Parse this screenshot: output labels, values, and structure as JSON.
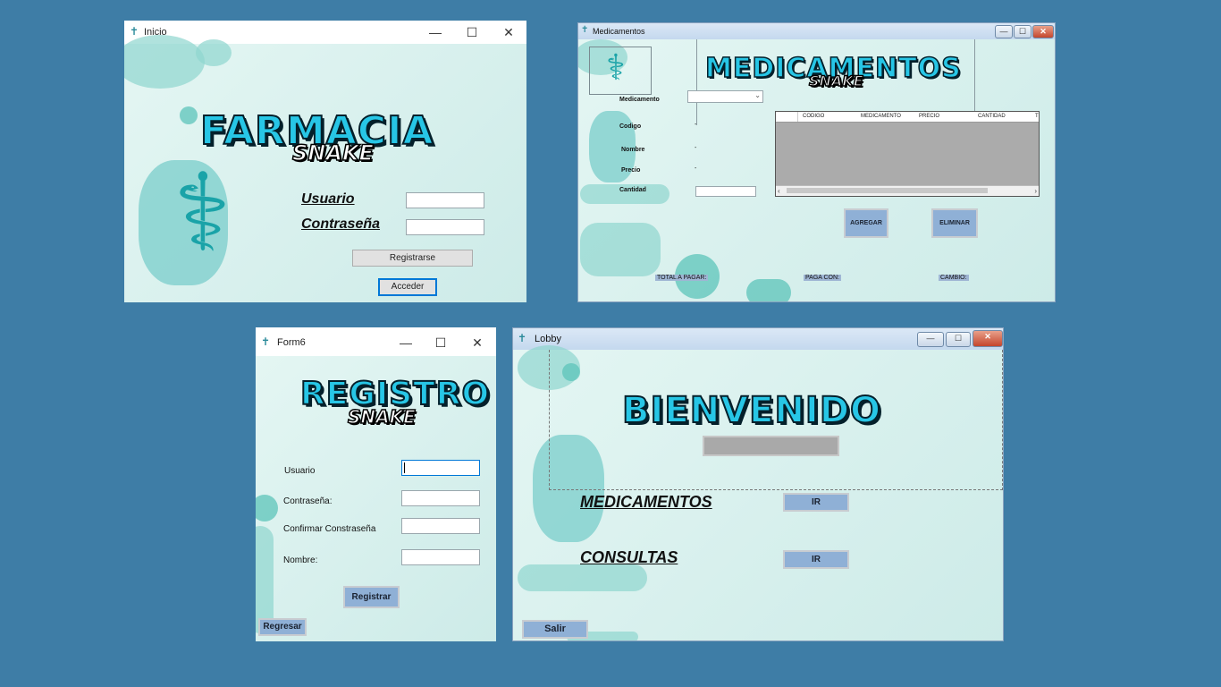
{
  "inicio": {
    "title": "Inicio",
    "logo": "FARMACIA",
    "logo_sub": "SNAKE",
    "usuario_label": "Usuario",
    "contrasena_label": "Contraseña",
    "registrarse_button": "Registrarse",
    "acceder_button": "Acceder"
  },
  "medicamentos": {
    "title": "Medicamentos",
    "logo": "MEDICAMENTOS",
    "logo_sub": "SNAKE",
    "fields": {
      "medicamento": "Medicamento",
      "codigo": "Codigo",
      "nombre": "Nombre",
      "precio": "Precio",
      "cantidad": "Cantidad"
    },
    "placeholder_dash": "-",
    "grid_columns": [
      "CODIGO",
      "MEDICAMENTO",
      "PRECIO",
      "CANTIDAD",
      "T"
    ],
    "agregar_button": "AGREGAR",
    "eliminar_button": "ELIMINAR",
    "total_label": "TOTAL A PAGAR:",
    "paga_con_label": "PAGA CON:",
    "cambio_label": "CAMBIO:"
  },
  "form6": {
    "title": "Form6",
    "logo": "REGISTRO",
    "logo_sub": "SNAKE",
    "usuario_label": "Usuario",
    "contrasena_label": "Contraseña:",
    "confirmar_label": "Confirmar Constraseña",
    "nombre_label": "Nombre:",
    "registrar_button": "Registrar",
    "regresar_button": "Regresar"
  },
  "lobby": {
    "title": "Lobby",
    "logo": "BIENVENIDO",
    "medicamentos_label": "MEDICAMENTOS",
    "consultas_label": "CONSULTAS",
    "ir_button": "IR",
    "salir_button": "Salir"
  },
  "icons": {
    "min": "—",
    "max": "☐",
    "close": "✕",
    "app": "✝"
  },
  "colors": {
    "background": "#3e7da6",
    "accent": "#27c6e6",
    "button_blue": "#8fb0d6"
  }
}
